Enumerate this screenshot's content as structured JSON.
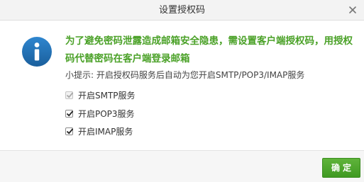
{
  "dialog": {
    "title": "设置授权码",
    "close_icon": "close-icon",
    "info_icon": "info-icon",
    "headline": "为了避免密码泄露造成邮箱安全隐患，需设置客户端授权码，用授权码代替密码在客户端登录邮箱",
    "tip": "小提示: 开启授权码服务后自动为您开启SMTP/POP3/IMAP服务",
    "options": [
      {
        "label": "开启SMTP服务",
        "checked": true,
        "disabled": true
      },
      {
        "label": "开启POP3服务",
        "checked": true,
        "disabled": false
      },
      {
        "label": "开启IMAP服务",
        "checked": true,
        "disabled": false
      }
    ],
    "confirm_label": "确定"
  },
  "colors": {
    "accent_green": "#4aa127",
    "info_blue": "#1f6fb2",
    "button_green": "#4ea62d"
  }
}
